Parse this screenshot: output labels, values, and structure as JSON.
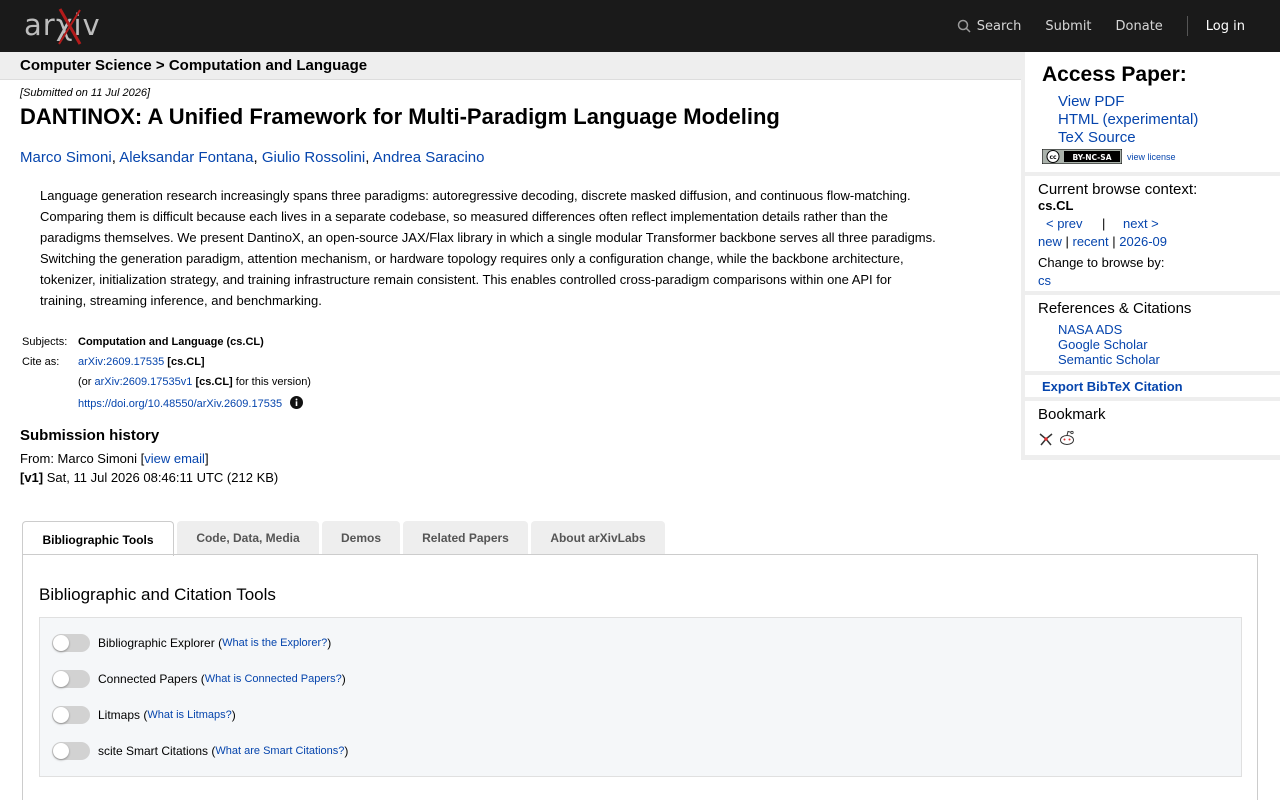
{
  "header": {
    "logo_alt": "arXiv",
    "search_label": "Search",
    "submit_label": "Submit",
    "donate_label": "Donate",
    "login_label": "Log in"
  },
  "breadcrumb": {
    "parent": "Computer Science",
    "sep": ">",
    "current": "Computation and Language"
  },
  "paper": {
    "submitted": "[Submitted on 11 Jul 2026]",
    "title": "DANTINOX: A Unified Framework for Multi-Paradigm Language Modeling",
    "authors": [
      "Marco Simoni",
      "Aleksandar Fontana",
      "Giulio Rossolini",
      "Andrea Saracino"
    ],
    "abstract_lines": [
      "Language generation research increasingly spans three paradigms: autoregressive decoding, discrete masked diffusion, and continuous flow-matching.",
      "Comparing them is difficult because each lives in a separate codebase, so measured differences often reflect implementation details rather than the",
      "paradigms themselves. We present DantinoX, an open-source JAX/Flax library in which a single modular Transformer backbone serves all three paradigms.",
      "Switching the generation paradigm, attention mechanism, or hardware topology requires only a configuration change, while the backbone architecture,",
      "tokenizer, initialization strategy, and training infrastructure remain consistent. This enables controlled cross-paradigm comparisons within one API for",
      "training, streaming inference, and benchmarking."
    ],
    "subjects_label": "Subjects:",
    "subjects_value": "Computation and Language (cs.CL)",
    "cite_label": "Cite as:",
    "cite_id": "arXiv:2609.17535",
    "cite_tag": "[cs.CL]",
    "cite_or": "(or",
    "cite_version_id": "arXiv:2609.17535v1",
    "cite_version_tag": "[cs.CL]",
    "cite_version_suffix": "for this version)",
    "doi": "https://doi.org/10.48550/arXiv.2609.17535",
    "history_title": "Submission history",
    "from_label": "From: Marco Simoni [",
    "view_email": "view email",
    "from_close": "]",
    "v1_label": "[v1]",
    "v1_value": "Sat, 11 Jul 2026 08:46:11 UTC (212 KB)"
  },
  "sidebar": {
    "access_title": "Access Paper:",
    "view_pdf": "View PDF",
    "html": "HTML (experimental)",
    "tex": "TeX Source",
    "cc_badge": "BY-NC-SA",
    "view_license": "view license",
    "context_title": "Current browse context:",
    "context_value": "cs.CL",
    "prev": "< prev",
    "pipe": "|",
    "next": "next >",
    "new": "new",
    "recent": "recent",
    "month": "2026-09",
    "change_label": "Change to browse by:",
    "cs": "cs",
    "refs_title": "References & Citations",
    "nasa": "NASA ADS",
    "google": "Google Scholar",
    "semantic": "Semantic Scholar",
    "export": "Export BibTeX Citation",
    "bookmark_title": "Bookmark"
  },
  "tabs": [
    {
      "label": "Bibliographic Tools"
    },
    {
      "label": "Code, Data, Media"
    },
    {
      "label": "Demos"
    },
    {
      "label": "Related Papers"
    },
    {
      "label": "About arXivLabs"
    }
  ],
  "panel": {
    "title": "Bibliographic and Citation Tools",
    "tools": [
      {
        "name": "Bibliographic Explorer",
        "help": "What is the Explorer?"
      },
      {
        "name": "Connected Papers",
        "help": "What is Connected Papers?"
      },
      {
        "name": "Litmaps",
        "help": "What is Litmaps?"
      },
      {
        "name": "scite Smart Citations",
        "help": "What are Smart Citations?"
      }
    ]
  }
}
